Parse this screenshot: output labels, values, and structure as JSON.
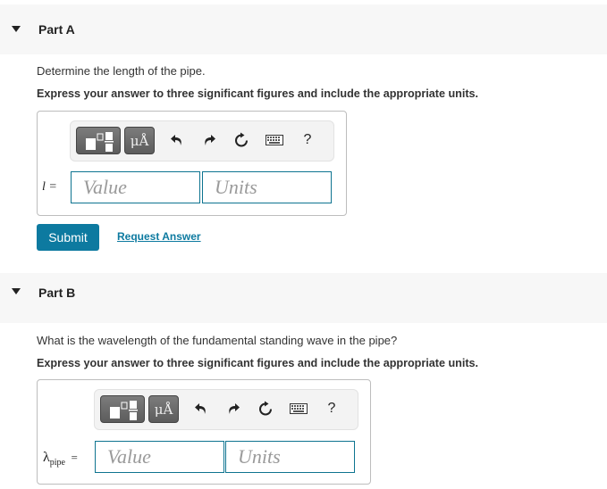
{
  "parts": [
    {
      "title": "Part A",
      "question": "Determine the length of the pipe.",
      "instruction": "Express your answer to three significant figures and include the appropriate units.",
      "variable_label": "l =",
      "value_placeholder": "Value",
      "units_placeholder": "Units",
      "submit_label": "Submit",
      "request_answer_label": "Request Answer"
    },
    {
      "title": "Part B",
      "question": "What is the wavelength of the fundamental standing wave in the pipe?",
      "instruction": "Express your answer to three significant figures and include the appropriate units.",
      "variable_symbol": "λ",
      "variable_subscript": "pipe",
      "variable_equals": "=",
      "value_placeholder": "Value",
      "units_placeholder": "Units"
    }
  ],
  "toolbar": {
    "templates_icon": "templates-icon",
    "units_symbol_label": "μÅ",
    "undo_icon": "undo-icon",
    "redo_icon": "redo-icon",
    "reset_icon": "reset-icon",
    "keyboard_icon": "keyboard-icon",
    "help_label": "?"
  },
  "colors": {
    "accent": "#0d7aa0",
    "field_border": "#0e7490",
    "header_bg": "#f7f7f7"
  }
}
